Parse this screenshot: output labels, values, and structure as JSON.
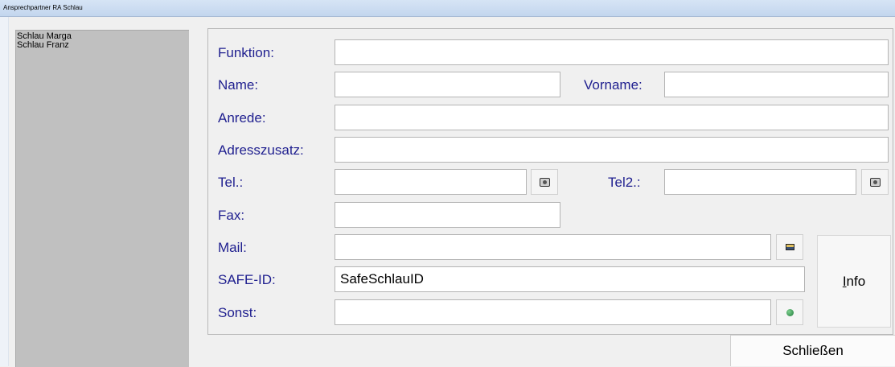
{
  "window": {
    "title": "Ansprechpartner RA Schlau"
  },
  "contacts": [
    "Schlau Marga",
    "Schlau Franz"
  ],
  "form": {
    "funktion": {
      "label": "Funktion:",
      "value": ""
    },
    "name": {
      "label": "Name:",
      "value": ""
    },
    "vorname": {
      "label": "Vorname:",
      "value": ""
    },
    "anrede": {
      "label": "Anrede:",
      "value": ""
    },
    "adresszusatz": {
      "label": "Adresszusatz:",
      "value": ""
    },
    "tel": {
      "label": "Tel.:",
      "value": ""
    },
    "tel2": {
      "label": "Tel2.:",
      "value": ""
    },
    "fax": {
      "label": "Fax:",
      "value": ""
    },
    "mail": {
      "label": "Mail:",
      "value": ""
    },
    "safe_id": {
      "label": "SAFE-ID:",
      "value": "SafeSchlauID"
    },
    "sonst": {
      "label": "Sonst:",
      "value": ""
    }
  },
  "buttons": {
    "info_mnemonic": "I",
    "info_rest": "nfo",
    "close": "Schließen"
  },
  "icons": {
    "tel": "phone-icon",
    "tel2": "phone-icon",
    "mail": "mail-icon",
    "sonst": "globe-icon"
  }
}
